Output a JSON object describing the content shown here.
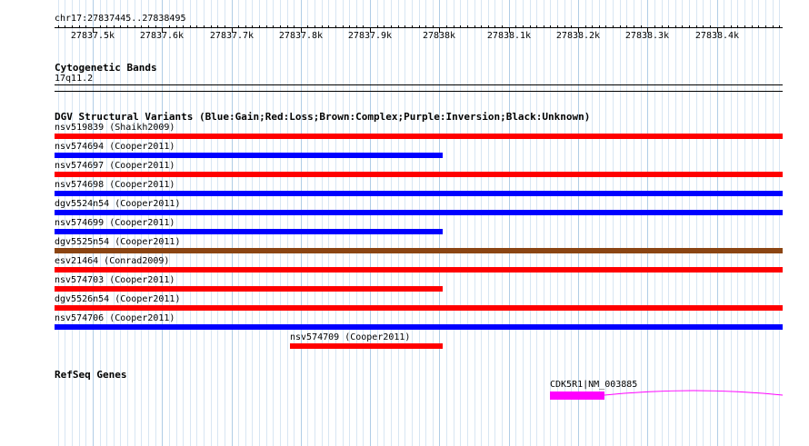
{
  "ruler": {
    "location": "chr17:27837445..27838495",
    "ticks": [
      {
        "label": "27837.5k",
        "pos": 27837500
      },
      {
        "label": "27837.6k",
        "pos": 27837600
      },
      {
        "label": "27837.7k",
        "pos": 27837700
      },
      {
        "label": "27837.8k",
        "pos": 27837800
      },
      {
        "label": "27837.9k",
        "pos": 27837900
      },
      {
        "label": "27838k",
        "pos": 27838000
      },
      {
        "label": "27838.1k",
        "pos": 27838100
      },
      {
        "label": "27838.2k",
        "pos": 27838200
      },
      {
        "label": "27838.3k",
        "pos": 27838300
      },
      {
        "label": "27838.4k",
        "pos": 27838400
      }
    ]
  },
  "cytobands": {
    "title": "Cytogenetic Bands",
    "band": "17q11.2"
  },
  "dgv": {
    "title": "DGV Structural Variants (Blue:Gain;Red:Loss;Brown:Complex;Purple:Inversion;Black:Unknown)",
    "variants": [
      {
        "label": "nsv519839 (Shaikh2009)",
        "type": "loss",
        "color": "#ff0000",
        "start": 27837445,
        "end": 27838495
      },
      {
        "label": "nsv574694 (Cooper2011)",
        "type": "gain",
        "color": "#0000ff",
        "start": 27837445,
        "end": 27838005
      },
      {
        "label": "nsv574697 (Cooper2011)",
        "type": "loss",
        "color": "#ff0000",
        "start": 27837445,
        "end": 27838495
      },
      {
        "label": "nsv574698 (Cooper2011)",
        "type": "gain",
        "color": "#0000ff",
        "start": 27837445,
        "end": 27838495
      },
      {
        "label": "dgv5524n54 (Cooper2011)",
        "type": "gain",
        "color": "#0000ff",
        "start": 27837445,
        "end": 27838495
      },
      {
        "label": "nsv574699 (Cooper2011)",
        "type": "gain",
        "color": "#0000ff",
        "start": 27837445,
        "end": 27838005
      },
      {
        "label": "dgv5525n54 (Cooper2011)",
        "type": "complex",
        "color": "#8b4513",
        "start": 27837445,
        "end": 27838495
      },
      {
        "label": "esv21464 (Conrad2009)",
        "type": "loss",
        "color": "#ff0000",
        "start": 27837445,
        "end": 27838495
      },
      {
        "label": "nsv574703 (Cooper2011)",
        "type": "loss",
        "color": "#ff0000",
        "start": 27837445,
        "end": 27838005
      },
      {
        "label": "dgv5526n54 (Cooper2011)",
        "type": "loss",
        "color": "#ff0000",
        "start": 27837445,
        "end": 27838495
      },
      {
        "label": "nsv574706 (Cooper2011)",
        "type": "gain",
        "color": "#0000ff",
        "start": 27837445,
        "end": 27838495
      },
      {
        "label": "nsv574709 (Cooper2011)",
        "type": "loss",
        "color": "#ff0000",
        "start": 27837785,
        "end": 27838005
      }
    ]
  },
  "refseq": {
    "title": "RefSeq Genes",
    "gene": {
      "label": "CDK5R1|NM_003885",
      "color": "#ff00ff",
      "exon_start": 27838160,
      "exon_end": 27838238,
      "intron_end": 27838495
    }
  }
}
